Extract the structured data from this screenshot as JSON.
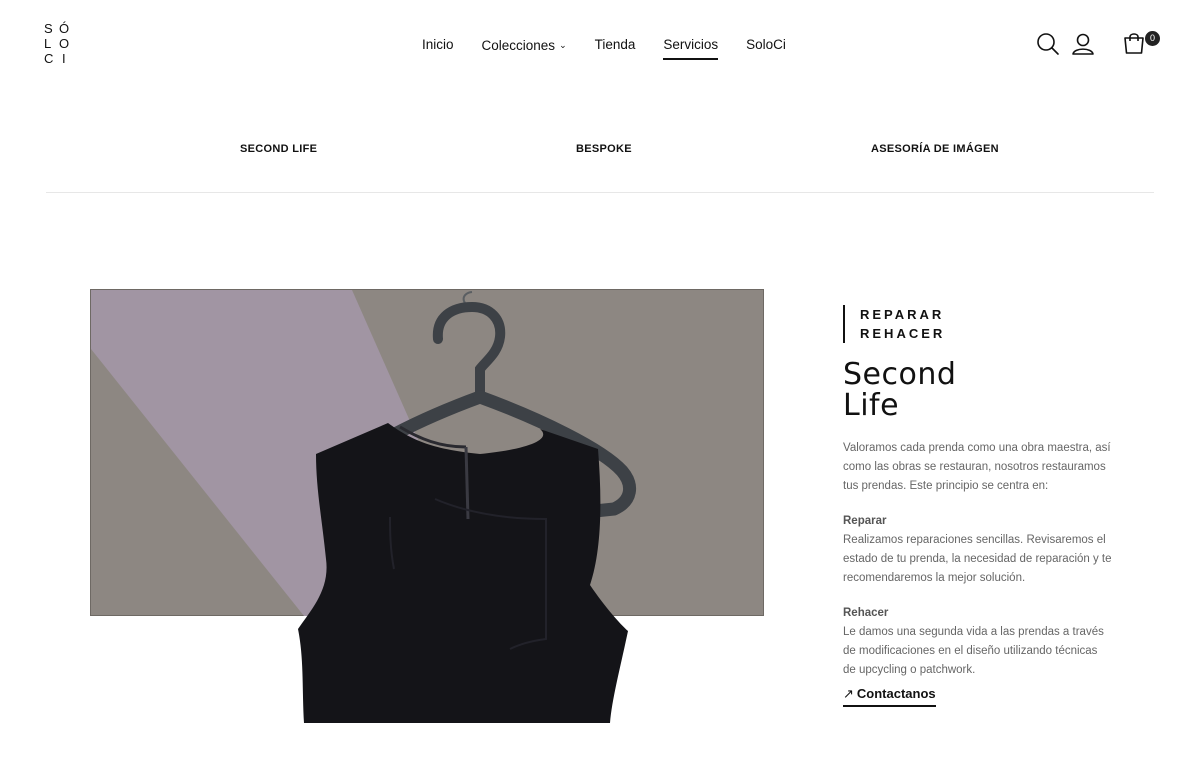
{
  "logo": {
    "letters": [
      "S",
      "Ó",
      "L",
      "O",
      "C",
      "I"
    ]
  },
  "nav": {
    "items": [
      {
        "label": "Inicio"
      },
      {
        "label": "Colecciones",
        "chevron": "⌄"
      },
      {
        "label": "Tienda"
      },
      {
        "label": "Servicios",
        "active": true
      },
      {
        "label": "SoloCi"
      }
    ]
  },
  "header_icons": {
    "search": "search-icon",
    "account": "user-icon",
    "cart": "shopping-bag-icon",
    "cart_count": "0"
  },
  "subtabs": [
    {
      "label": "SECOND LIFE"
    },
    {
      "label": "BESPOKE"
    },
    {
      "label": "ASESORÍA DE IMÁGEN"
    }
  ],
  "section": {
    "eyebrow_1": "REPARAR",
    "eyebrow_2": "REHACER",
    "title_1": "Second",
    "title_2": "Life",
    "intro": "Valoramos cada prenda como una obra maestra, así como las obras se restauran, nosotros restauramos tus prendas. Este principio se centra en:",
    "reparar_heading": "Reparar",
    "reparar_text": "Realizamos reparaciones sencillas. Revisaremos el estado de tu prenda, la necesidad de reparación y te recomendaremos la mejor solución.",
    "rehacer_heading": "Rehacer",
    "rehacer_text": "Le damos una segunda vida a las prendas a través de modificaciones en el diseño utilizando técnicas de upcycling o patchwork.",
    "cta_label": "Contactanos",
    "cta_icon": "arrow-up-right-icon"
  },
  "colors": {
    "background": "#ffffff",
    "image_grey": "#8d8782",
    "image_lilac": "#a195a3",
    "dress": "#141418",
    "hanger": "#3d4146",
    "text_muted": "#666666"
  }
}
